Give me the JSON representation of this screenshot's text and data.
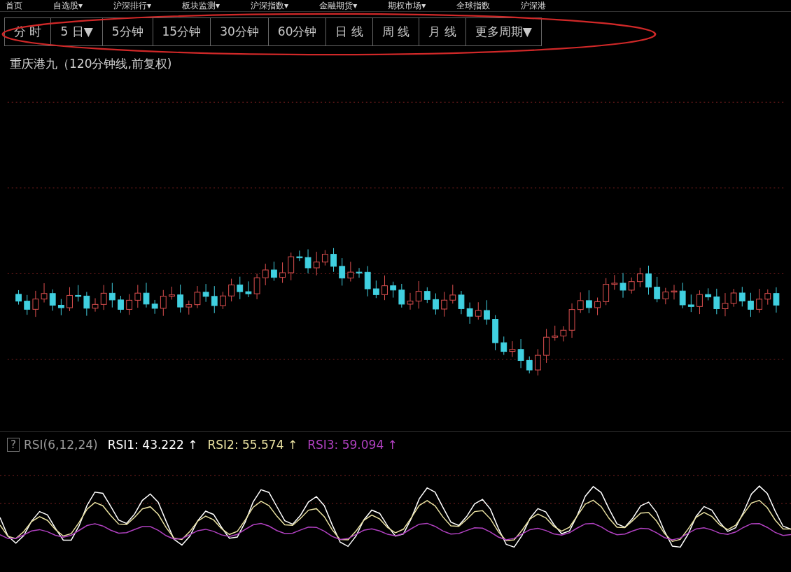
{
  "top_menu": [
    {
      "label": "首页"
    },
    {
      "label": "自选股",
      "caret": "▾"
    },
    {
      "label": "沪深排行",
      "caret": "▾"
    },
    {
      "label": "板块监测",
      "caret": "▾"
    },
    {
      "label": "沪深指数",
      "caret": "▾"
    },
    {
      "label": "金融期货",
      "caret": "▾"
    },
    {
      "label": "期权市场",
      "caret": "▾"
    },
    {
      "label": "全球指数"
    },
    {
      "label": "沪深港"
    }
  ],
  "periods": [
    {
      "label": "分 时"
    },
    {
      "label": "5 日",
      "caret": "▼"
    },
    {
      "label": "5分钟"
    },
    {
      "label": "15分钟"
    },
    {
      "label": "30分钟"
    },
    {
      "label": "60分钟"
    },
    {
      "label": "日 线"
    },
    {
      "label": "周 线"
    },
    {
      "label": "月 线"
    },
    {
      "label": "更多周期",
      "caret": "▼"
    }
  ],
  "chart_title": "重庆港九（120分钟线,前复权)",
  "indicator": {
    "help": "?",
    "name": "RSI(6,12,24)",
    "series": [
      {
        "label": "RSI1: 43.222",
        "arrow": "↑",
        "color": "#ffffff"
      },
      {
        "label": "RSI2: 55.574",
        "arrow": "↑",
        "color": "#e8e0a0"
      },
      {
        "label": "RSI3: 59.094",
        "arrow": "↑",
        "color": "#b040c0"
      }
    ]
  }
}
